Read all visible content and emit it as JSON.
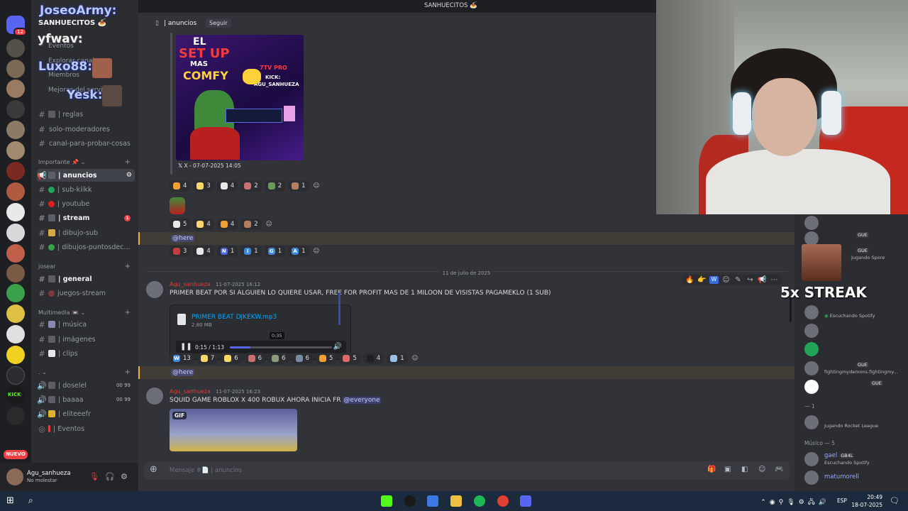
{
  "top": {
    "server_title": "SANHUECITOS 🍝"
  },
  "sidebar": {
    "guild_name": "SANHUECITOS 🍝",
    "links": [
      "Eventos",
      "Explorar canales",
      "Miembros",
      "Mejoras del servidor"
    ],
    "channels_top": [
      {
        "label": "| reglas",
        "icon": "book"
      },
      {
        "label": "solo-moderadores",
        "icon": "hash"
      },
      {
        "label": "canal-para-probar-cosas",
        "icon": "hash"
      }
    ],
    "cat_importante": "Importante 📌",
    "channels_importante": [
      {
        "label": "| anuncios",
        "active": true
      },
      {
        "label": "| sub-kiikk",
        "dot": "#23a559"
      },
      {
        "label": "| youtube",
        "dot": "#e01e1e"
      },
      {
        "label": "| stream",
        "badge": "1"
      },
      {
        "label": "| dibujo-sub"
      },
      {
        "label": "| dibujos-puntosdec..."
      }
    ],
    "cat_josear": "josear",
    "channels_josear": [
      {
        "label": "| general"
      },
      {
        "label": "juegos-stream"
      }
    ],
    "cat_multimedia": "Multimedia 📼",
    "channels_multimedia": [
      {
        "label": "| música"
      },
      {
        "label": "| imágenes"
      },
      {
        "label": "| clips"
      }
    ],
    "cat_voice": ". ",
    "channels_voice": [
      {
        "label": "| doselel",
        "count": "00 99"
      },
      {
        "label": "| baaaa",
        "count": "00 99"
      },
      {
        "label": "| eliteeefr"
      },
      {
        "label": "| Eventos"
      }
    ],
    "overlay_names": [
      "JoseoArmy:",
      "yfwav:",
      "Luxo88:",
      "Yesk:"
    ]
  },
  "rail": {
    "home_badge": "12",
    "new_label": "NUEVO"
  },
  "user": {
    "name": "Agu_sanhueza",
    "status": "No molestar"
  },
  "channel": {
    "name": "| anuncios",
    "follow_label": "Seguir"
  },
  "embed": {
    "art_title_1": "EL",
    "art_title_2": "SET UP",
    "art_title_3": "MAS",
    "art_title_4": "COMFY",
    "art_badge": "7TV PRO",
    "art_kick": "KICK:",
    "art_handle": "AGU_SANHUEZA",
    "footer": "X - 07-07-2025 14:05"
  },
  "reactions_1": [
    {
      "emoji_color": "#f0a030",
      "count": "4"
    },
    {
      "emoji_color": "#ffd86a",
      "count": "3"
    },
    {
      "emoji_color": "#e8e8e8",
      "count": "4"
    },
    {
      "emoji_color": "#c97070",
      "count": "2"
    },
    {
      "emoji_color": "#6a9a5a",
      "count": "2"
    },
    {
      "emoji_color": "#b08060",
      "count": "1"
    }
  ],
  "reactions_2": [
    {
      "emoji_color": "#e8e8e8",
      "count": "5"
    },
    {
      "emoji_color": "#ffd86a",
      "count": "4"
    },
    {
      "emoji_color": "#f0a030",
      "count": "4"
    },
    {
      "emoji_color": "#b08060",
      "count": "2"
    }
  ],
  "reactions_3": [
    {
      "emoji_color": "#c04040",
      "count": "3"
    },
    {
      "emoji_color": "#e8e8e8",
      "count": "4"
    },
    {
      "emoji_color": "#4a6adf",
      "count": "1",
      "letter": "N"
    },
    {
      "emoji_color": "#3a8adf",
      "count": "1",
      "letter": "I"
    },
    {
      "emoji_color": "#3a8adf",
      "count": "1",
      "letter": "G"
    },
    {
      "emoji_color": "#3a8adf",
      "count": "1",
      "letter": "A"
    }
  ],
  "mention_here": "@here",
  "date_divider": "11 de julio de 2025",
  "msg1": {
    "author": "Agu_sanhueza",
    "time": "11-07-2025 16:12",
    "text": "PRIMER BEAT POR SI ALGUIEN LO QUIERE USAR, FREE FOR PROFIT MAS DE 1 MILOON DE VISISTAS PAGAMEKLO (1 SUB)",
    "file_name": "PRIMER BEAT DJKEKW.mp3",
    "file_size": "2.80 MB",
    "audio_time": "0:15 / 1:13",
    "audio_progress": 0.2,
    "hover_time": "0:35"
  },
  "reactions_4": [
    {
      "emoji_color": "#3a8adf",
      "count": "13",
      "letter": "W"
    },
    {
      "emoji_color": "#ffd86a",
      "count": "7"
    },
    {
      "emoji_color": "#ffd86a",
      "count": "6"
    },
    {
      "emoji_color": "#c97070",
      "count": "6"
    },
    {
      "emoji_color": "#8a9a7a",
      "count": "6"
    },
    {
      "emoji_color": "#7a8aa0",
      "count": "6"
    },
    {
      "emoji_color": "#f0a030",
      "count": "5"
    },
    {
      "emoji_color": "#e06a6a",
      "count": "5"
    },
    {
      "emoji_color": "#202020",
      "count": "4"
    },
    {
      "emoji_color": "#9ac0e8",
      "count": "1"
    }
  ],
  "msg2": {
    "author": "Agu_sanhueza",
    "time": "11-07-2025 16:23",
    "text": "SQUID GAME ROBLOX X 400 ROBUX AHORA INICIA FR",
    "mention": "@everyone",
    "gif_label": "GIF"
  },
  "composer": {
    "placeholder": "Mensaje #📄 | anuncios"
  },
  "members": {
    "items": [
      {
        "name": "",
        "tag": "",
        "status": ""
      },
      {
        "name": "",
        "tag": "GUE",
        "status": ""
      },
      {
        "name": "",
        "tag": "GUE",
        "status": "Jugando Spore"
      },
      {
        "name": "",
        "tag": "",
        "status": ""
      },
      {
        "name": "",
        "tag": "",
        "status": "Escuchando Spotify"
      },
      {
        "name": "",
        "tag": "",
        "status": ""
      },
      {
        "name": "",
        "tag": "",
        "status": ""
      },
      {
        "name": "",
        "tag": "GUE",
        "status": "fightingmydemons.fightingmy..."
      },
      {
        "name": "",
        "tag": "GUE",
        "status": ""
      }
    ],
    "cat_1": "— 1",
    "member_rl": {
      "name": "",
      "status": "Jugando Rocket League"
    },
    "cat_musico": "Músico — 5",
    "member_gael": {
      "name": "gael",
      "tag": "GB4L",
      "status": "Escuchando Spotify"
    },
    "member_mat": {
      "name": "matumorell",
      "status": ""
    }
  },
  "overlay": {
    "streak": "5x STREAK"
  },
  "taskbar": {
    "lang": "ESP",
    "time": "20:49",
    "date": "18-07-2025"
  }
}
